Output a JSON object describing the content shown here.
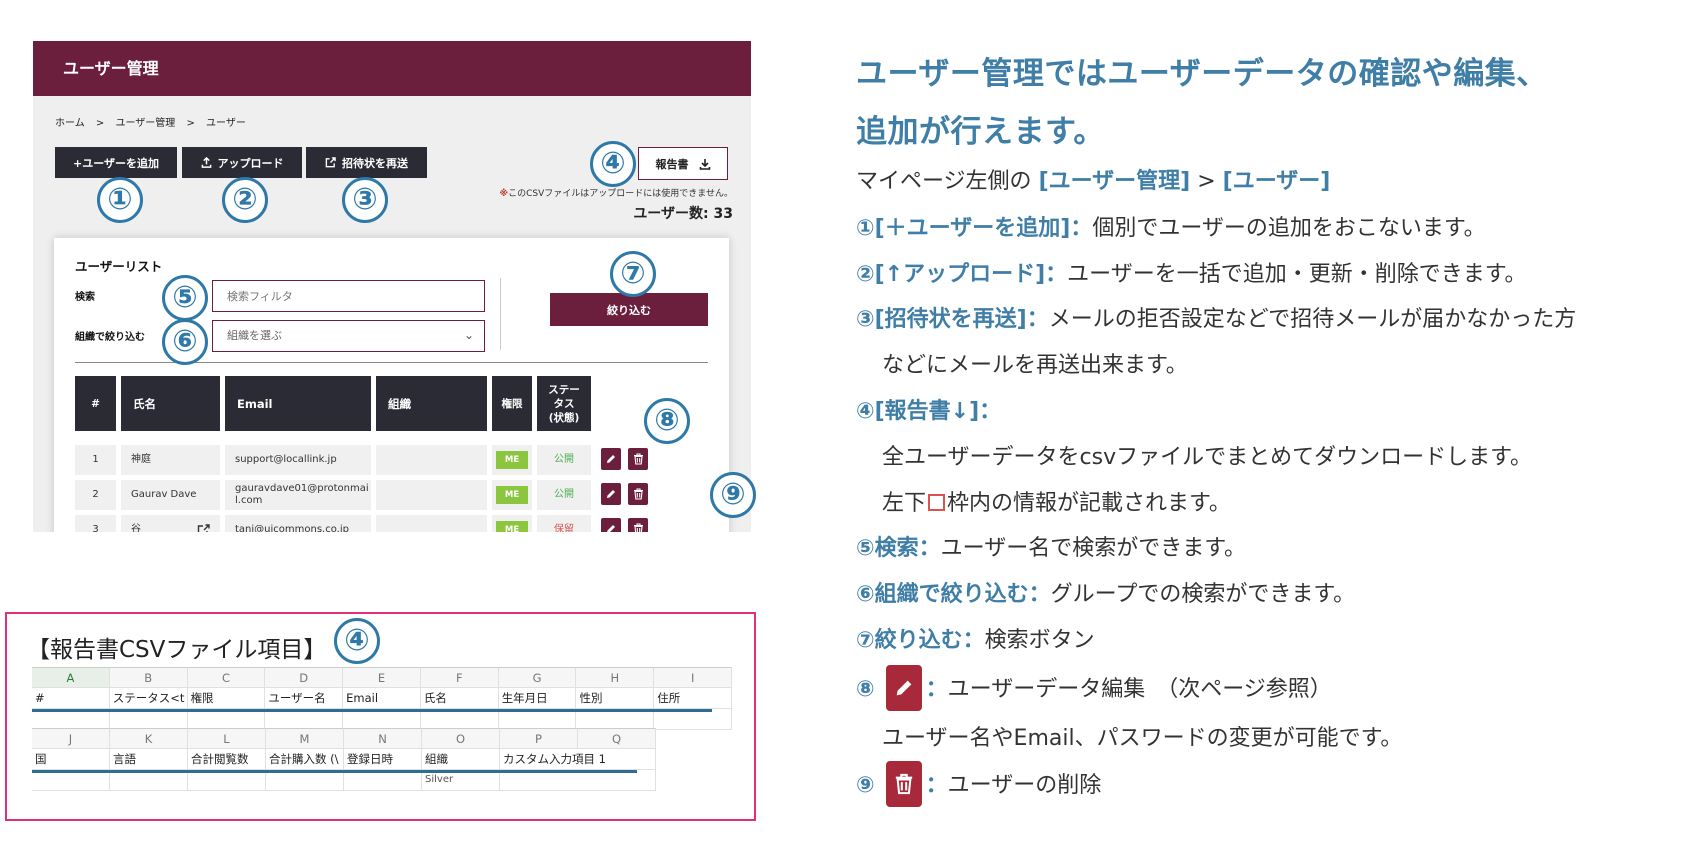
{
  "screen": {
    "title": "ユーザー管理",
    "breadcrumb": [
      "ホーム",
      ">",
      "ユーザー管理",
      ">",
      "ユーザー"
    ],
    "toolbar": {
      "add_user": "+ユーザーを追加",
      "upload": "アップロード",
      "resend": "招待状を再送",
      "report": "報告書"
    },
    "csv_note_mark": "※",
    "csv_note": "このCSVファイルはアップロードには使用できません。",
    "user_count": "ユーザー数: 33",
    "user_list": {
      "title": "ユーザーリスト",
      "search_label": "検索",
      "search_placeholder": "検索フィルタ",
      "org_label": "組織で絞り込む",
      "org_select": "組織を選ぶ",
      "filter_button": "絞り込む"
    },
    "table": {
      "headers": [
        "#",
        "氏名",
        "Email",
        "組織",
        "権限",
        "ステータス(状態)"
      ],
      "status_header_lines": [
        "ステー",
        "タス",
        "(状態)"
      ],
      "rows": [
        {
          "num": "1",
          "name": "神庭",
          "email": "support@locallink.jp",
          "org": "",
          "role": "ME",
          "status": "公開"
        },
        {
          "num": "2",
          "name": "Gaurav Dave",
          "email": "gauravdave01@protonmail.com",
          "email_lines": [
            "gauravdave01@protonmai",
            "l.com"
          ],
          "org": "",
          "role": "ME",
          "status": "公開"
        },
        {
          "num": "3",
          "name": "谷",
          "email": "tani@uicommons.co.jp",
          "org": "",
          "role": "ME",
          "status": "保留"
        }
      ]
    }
  },
  "callouts": {
    "c1": "①",
    "c2": "②",
    "c3": "③",
    "c4": "④",
    "c5": "⑤",
    "c6": "⑥",
    "c7": "⑦",
    "c8": "⑧",
    "c9": "⑨"
  },
  "csv_items": {
    "title": "【報告書CSVファイル項目】",
    "row1_cols": [
      "A",
      "B",
      "C",
      "D",
      "E",
      "F",
      "G",
      "H",
      "I"
    ],
    "row1_values": [
      "#",
      "ステータス<t",
      "権限",
      "ユーザー名",
      "Email",
      "氏名",
      "生年月日",
      "性別",
      "住所"
    ],
    "row2_cols": [
      "J",
      "K",
      "L",
      "M",
      "N",
      "O",
      "P",
      "Q"
    ],
    "row2_values": [
      "国",
      "言語",
      "合計閲覧数",
      "合計購入数 (\\",
      "登録日時",
      "組織",
      "カスタム入力項目 1",
      ""
    ],
    "row2_extra": "Silver"
  },
  "explanation": {
    "heading_line1": "ユーザー管理ではユーザーデータの確認や編集、",
    "heading_line2": "追加が行えます。",
    "path_prefix": "マイページ左側の",
    "path_a": "[ユーザー管理]",
    "path_sep": " > ",
    "path_b": "[ユーザー]",
    "i1_key": "①[＋ユーザーを追加]：",
    "i1_text": "個別でユーザーの追加をおこないます。",
    "i2_key": "②[↑アップロード]：",
    "i2_text": "ユーザーを一括で追加・更新・削除できます。",
    "i3_key": "③[招待状を再送]：",
    "i3_text": "メールの拒否設定などで招待メールが届かなかった方",
    "i3_text2": "などにメールを再送出来ます。",
    "i4_key": "④[報告書↓]：",
    "i4_text": "全ユーザーデータをcsvファイルでまとめてダウンロードします。",
    "i4_text2a": "左下",
    "i4_text2b": "枠内の情報が記載されます。",
    "i5_key": "⑤検索：",
    "i5_text": "ユーザー名で検索ができます。",
    "i6_key": "⑥組織で絞り込む：",
    "i6_text": "グループでの検索ができます。",
    "i7_key": "⑦絞り込む：",
    "i7_text": "検索ボタン",
    "i8_num": "⑧",
    "i8_colon": "：",
    "i8_text": "ユーザーデータ編集　（次ページ参照）",
    "i8_text2": "ユーザー名やEmail、パスワードの変更が可能です。",
    "i9_num": "⑨",
    "i9_colon": "：",
    "i9_text": "ユーザーの削除"
  },
  "colors": {
    "brand": "#6b1f3c",
    "dark_button": "#2b2b35",
    "callout_blue": "#2e79a7",
    "heading_blue": "#3f7ea6",
    "highlight_pink": "#e0307a",
    "role_green": "#8cc63f"
  }
}
